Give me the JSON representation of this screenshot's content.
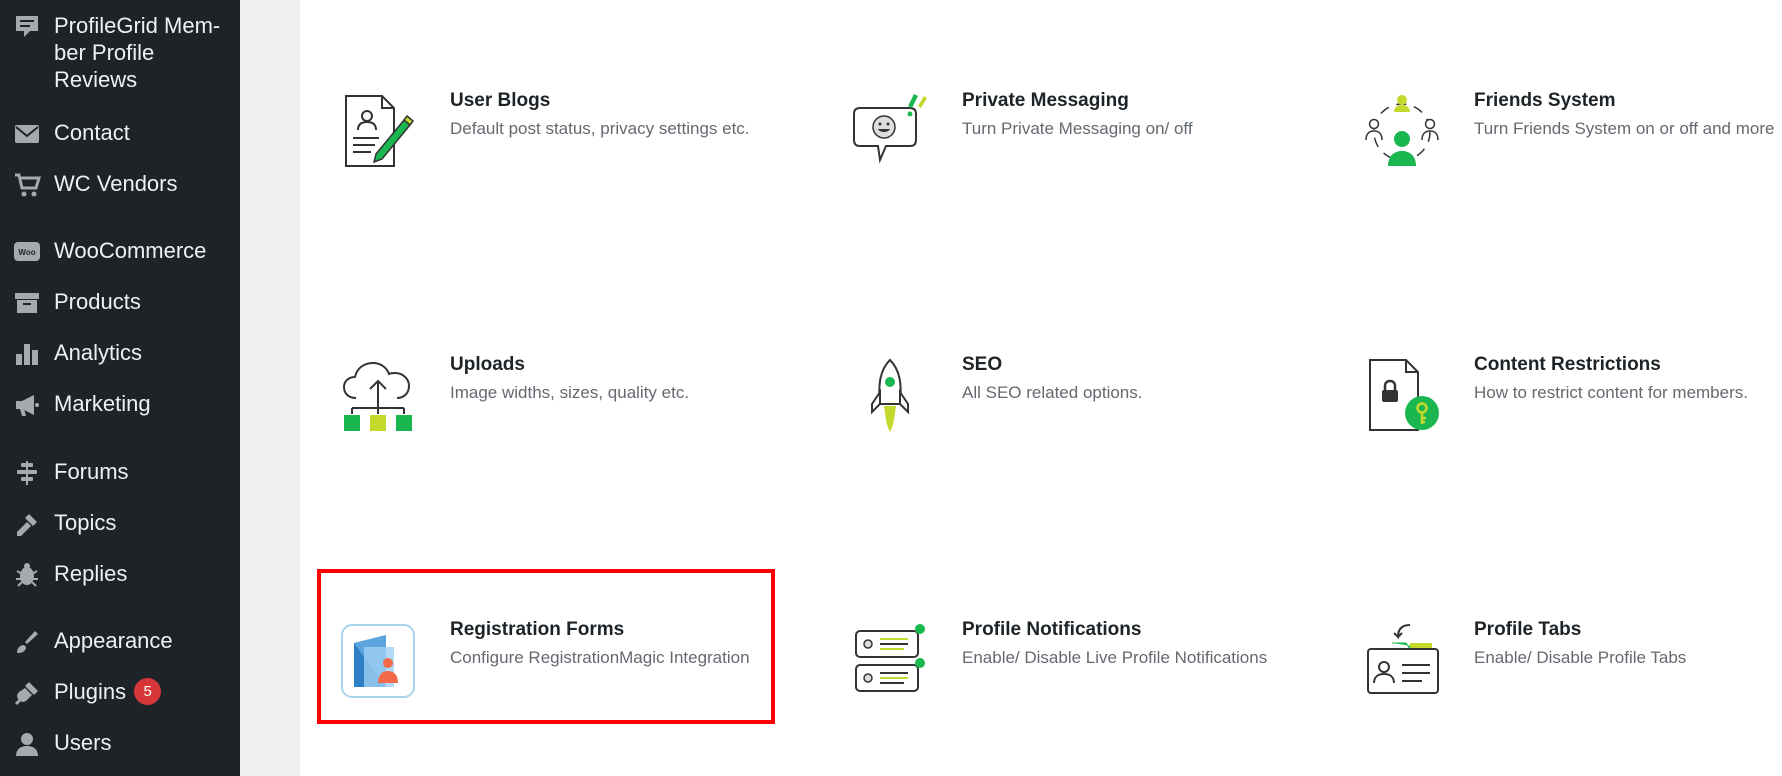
{
  "sidebar": {
    "items": [
      {
        "label": "ProfileGrid Mem-ber Profile Reviews",
        "icon": "comment-icon"
      },
      {
        "label": "Contact",
        "icon": "envelope-icon"
      },
      {
        "label": "WC Vendors",
        "icon": "cart-icon"
      },
      {
        "label": "WooCommerce",
        "icon": "woo-icon"
      },
      {
        "label": "Products",
        "icon": "archive-box-icon"
      },
      {
        "label": "Analytics",
        "icon": "bar-chart-icon"
      },
      {
        "label": "Marketing",
        "icon": "megaphone-icon"
      },
      {
        "label": "Forums",
        "icon": "forums-icon"
      },
      {
        "label": "Topics",
        "icon": "topics-icon"
      },
      {
        "label": "Replies",
        "icon": "replies-icon"
      },
      {
        "label": "Appearance",
        "icon": "paintbrush-icon"
      },
      {
        "label": "Plugins",
        "icon": "plugin-icon",
        "badge": "5"
      },
      {
        "label": "Users",
        "icon": "user-icon"
      }
    ]
  },
  "cards": [
    {
      "title": "User Blogs",
      "desc": "Default post status, privacy settings etc.",
      "icon": "user-blogs-icon"
    },
    {
      "title": "Private Messaging",
      "desc": "Turn Private Messaging on/ off",
      "icon": "private-messaging-icon"
    },
    {
      "title": "Friends System",
      "desc": "Turn Friends System on or off and more",
      "icon": "friends-system-icon"
    },
    {
      "title": "Uploads",
      "desc": "Image widths, sizes, quality etc.",
      "icon": "uploads-cloud-icon"
    },
    {
      "title": "SEO",
      "desc": "All SEO related options.",
      "icon": "seo-rocket-icon"
    },
    {
      "title": "Content Restrictions",
      "desc": "How to restrict content for members.",
      "icon": "content-restrictions-icon"
    },
    {
      "title": "Registration Forms",
      "desc": "Configure RegistrationMagic Integration",
      "icon": "registration-forms-icon"
    },
    {
      "title": "Profile Notifications",
      "desc": "Enable/ Disable Live Profile Notifications",
      "icon": "profile-notifications-icon"
    },
    {
      "title": "Profile Tabs",
      "desc": "Enable/ Disable Profile Tabs",
      "icon": "profile-tabs-icon"
    }
  ],
  "colors": {
    "sidebar_bg": "#1d2327",
    "accent_green": "#1ab64f",
    "accent_lime": "#c5d92d",
    "highlight": "#ff0000",
    "badge": "#d63638"
  }
}
